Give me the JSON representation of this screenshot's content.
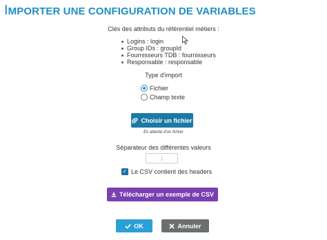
{
  "dialog": {
    "title_first": "I",
    "title_rest": "MPORTER UNE CONFIGURATION DE VARIABLES"
  },
  "attributes": {
    "title": "Clés des attributs du référentiel métiers :",
    "items": [
      {
        "label": "Logins : login"
      },
      {
        "label": "Group IDs : groupId"
      },
      {
        "label": "Fournisseurs TDB : fournisseurs"
      },
      {
        "label": "Responsable : responsable"
      }
    ]
  },
  "import_type": {
    "label": "Type d'import",
    "options": [
      {
        "label": "Fichier",
        "selected": true
      },
      {
        "label": "Champ texte",
        "selected": false
      }
    ]
  },
  "file": {
    "choose_label": "Choisir un fichier",
    "choose_icon": "paperclip-icon",
    "status": "En attente d'un fichier"
  },
  "separator": {
    "label": "Séparateur des différentes valeurs",
    "value": ";"
  },
  "csv_headers": {
    "label": "Le CSV contient des headers",
    "checked": true
  },
  "download": {
    "label": "Télécharger un exemple de CSV",
    "icon": "download-icon"
  },
  "footer": {
    "ok_label": "OK",
    "ok_icon": "check-icon",
    "cancel_label": "Annuler",
    "cancel_icon": "close-icon"
  },
  "colors": {
    "title": "#1f8ec2",
    "choose_button": "#1a7aa3",
    "download_button": "#7a3fb0",
    "ok_button": "#2b9fd6",
    "cancel_button": "#6b6f71",
    "checkbox": "#1f6fa8"
  }
}
